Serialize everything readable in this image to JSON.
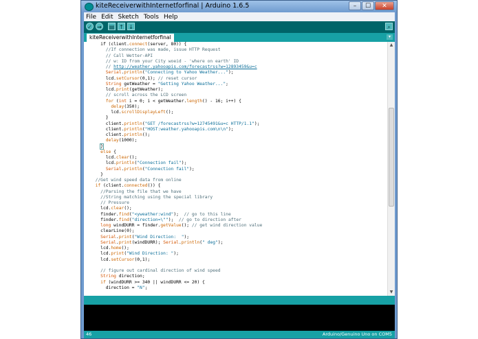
{
  "window": {
    "title": "kiteReceiverwithInternetforfinal | Arduino 1.6.5",
    "minimize": "–",
    "maximize": "☐",
    "close": "✕"
  },
  "menu": [
    "File",
    "Edit",
    "Sketch",
    "Tools",
    "Help"
  ],
  "toolbar": {
    "verify": "✓",
    "upload": "→",
    "new": "▤",
    "open": "↑",
    "save": "↓",
    "serial_monitor": "⌕"
  },
  "tabs": {
    "active": "kiteReceiverwithInternetforfinal",
    "menu_glyph": "▾"
  },
  "code": [
    [
      [
        "    ",
        ""
      ],
      [
        "if (client.",
        ""
      ],
      [
        "connect",
        "k"
      ],
      [
        "(server, 80)) {",
        ""
      ]
    ],
    [
      [
        "      //If connection was made, issue HTTP Request",
        "c"
      ]
    ],
    [
      [
        "      // Call Wetter-API",
        "c"
      ]
    ],
    [
      [
        "      // w: ID from your City woeid - 'where on earth' ID",
        "c"
      ]
    ],
    [
      [
        "      // ",
        "c"
      ],
      [
        "http://weather.yahooapis.com/forecastrss?w=12893459&u=c",
        "u"
      ]
    ],
    [
      [
        "      ",
        ""
      ],
      [
        "Serial",
        "t"
      ],
      [
        ".",
        ""
      ],
      [
        "println",
        "k"
      ],
      [
        "(",
        ""
      ],
      [
        "\"Connecting to Yahoo Weather...\"",
        "s"
      ],
      [
        ");",
        ""
      ]
    ],
    [
      [
        "      lcd.",
        ""
      ],
      [
        "setCursor",
        "k"
      ],
      [
        "(0,1); ",
        ""
      ],
      [
        "// reset cursor",
        "c"
      ]
    ],
    [
      [
        "      ",
        ""
      ],
      [
        "String",
        "t"
      ],
      [
        " getWeather = ",
        ""
      ],
      [
        "\"Getting Yahoo Weather...\"",
        "s"
      ],
      [
        ";",
        ""
      ]
    ],
    [
      [
        "      lcd.",
        ""
      ],
      [
        "print",
        "k"
      ],
      [
        "(getWeather);",
        ""
      ]
    ],
    [
      [
        "      // scroll across the LCD screen",
        "c"
      ]
    ],
    [
      [
        "      ",
        ""
      ],
      [
        "for",
        "k"
      ],
      [
        " (",
        ""
      ],
      [
        "int",
        "t"
      ],
      [
        " i = 0; i < getWeather.",
        ""
      ],
      [
        "length",
        "k"
      ],
      [
        "() - 16; i++) {",
        ""
      ]
    ],
    [
      [
        "        ",
        ""
      ],
      [
        "delay",
        "k"
      ],
      [
        "(350);",
        ""
      ]
    ],
    [
      [
        "        lcd.",
        ""
      ],
      [
        "scrollDisplayLeft",
        "k"
      ],
      [
        "();",
        ""
      ]
    ],
    [
      [
        "      }",
        ""
      ]
    ],
    [
      [
        "      client.",
        ""
      ],
      [
        "println",
        "k"
      ],
      [
        "(",
        ""
      ],
      [
        "\"GET /forecastrss?w=12745491&u=c HTTP/1.1\"",
        "s"
      ],
      [
        ");",
        ""
      ]
    ],
    [
      [
        "      client.",
        ""
      ],
      [
        "println",
        "k"
      ],
      [
        "(",
        ""
      ],
      [
        "\"HOST:weather.yahooapis.com\\n\\n\"",
        "s"
      ],
      [
        ");",
        ""
      ]
    ],
    [
      [
        "      client.",
        ""
      ],
      [
        "println",
        "k"
      ],
      [
        "();",
        ""
      ]
    ],
    [
      [
        "      ",
        ""
      ],
      [
        "delay",
        "k"
      ],
      [
        "(1000);",
        ""
      ]
    ],
    [
      [
        "    ",
        ""
      ],
      [
        "}",
        "x"
      ]
    ],
    [
      [
        "    ",
        ""
      ],
      [
        "else",
        "k"
      ],
      [
        " {",
        ""
      ]
    ],
    [
      [
        "      lcd.",
        ""
      ],
      [
        "clear",
        "k"
      ],
      [
        "();",
        ""
      ]
    ],
    [
      [
        "      lcd.",
        ""
      ],
      [
        "println",
        "k"
      ],
      [
        "(",
        ""
      ],
      [
        "\"Connection fail\"",
        "s"
      ],
      [
        ");",
        ""
      ]
    ],
    [
      [
        "      ",
        ""
      ],
      [
        "Serial",
        "t"
      ],
      [
        ".",
        ""
      ],
      [
        "println",
        "k"
      ],
      [
        "(",
        ""
      ],
      [
        "\"Connection fail\"",
        "s"
      ],
      [
        ");",
        ""
      ]
    ],
    [
      [
        "    }",
        ""
      ]
    ],
    [
      [
        "  ",
        ""
      ],
      [
        "//Get wind speed data from online",
        "c"
      ]
    ],
    [
      [
        "  ",
        ""
      ],
      [
        "if",
        "k"
      ],
      [
        " (client.",
        ""
      ],
      [
        "connected",
        "k"
      ],
      [
        "()) {",
        ""
      ]
    ],
    [
      [
        "    //Parsing the file that we have",
        "c"
      ]
    ],
    [
      [
        "    //String matching using the special library",
        "c"
      ]
    ],
    [
      [
        "    // Pressure",
        "c"
      ]
    ],
    [
      [
        "    lcd.",
        ""
      ],
      [
        "clear",
        "k"
      ],
      [
        "();",
        ""
      ]
    ],
    [
      [
        "    finder.",
        ""
      ],
      [
        "find",
        "k"
      ],
      [
        "(",
        ""
      ],
      [
        "\"<yweather:wind\"",
        "s"
      ],
      [
        ");  ",
        ""
      ],
      [
        "// go to this line",
        "c"
      ]
    ],
    [
      [
        "    finder.",
        ""
      ],
      [
        "find",
        "k"
      ],
      [
        "(",
        ""
      ],
      [
        "\"direction=\\\"\"",
        "s"
      ],
      [
        ");  ",
        ""
      ],
      [
        "// go to direction after",
        "c"
      ]
    ],
    [
      [
        "    ",
        ""
      ],
      [
        "long",
        "t"
      ],
      [
        " windDURR = finder.",
        ""
      ],
      [
        "getValue",
        "k"
      ],
      [
        "(); ",
        ""
      ],
      [
        "// get wind direction value",
        "c"
      ]
    ],
    [
      [
        "    clearLine(0);",
        ""
      ]
    ],
    [
      [
        "    ",
        ""
      ],
      [
        "Serial",
        "t"
      ],
      [
        ".",
        ""
      ],
      [
        "print",
        "k"
      ],
      [
        "(",
        ""
      ],
      [
        "\"Wind Direction:  \"",
        "s"
      ],
      [
        ");",
        ""
      ]
    ],
    [
      [
        "    ",
        ""
      ],
      [
        "Serial",
        "t"
      ],
      [
        ".",
        ""
      ],
      [
        "print",
        "k"
      ],
      [
        "(windDURR); ",
        ""
      ],
      [
        "Serial",
        "t"
      ],
      [
        ".",
        ""
      ],
      [
        "println",
        "k"
      ],
      [
        "(",
        ""
      ],
      [
        "\" deg\"",
        "s"
      ],
      [
        ");",
        ""
      ]
    ],
    [
      [
        "    lcd.",
        ""
      ],
      [
        "home",
        "k"
      ],
      [
        "();",
        ""
      ]
    ],
    [
      [
        "    lcd.",
        ""
      ],
      [
        "print",
        "k"
      ],
      [
        "(",
        ""
      ],
      [
        "\"Wind Direction: \"",
        "s"
      ],
      [
        ");",
        ""
      ]
    ],
    [
      [
        "    lcd.",
        ""
      ],
      [
        "setCursor",
        "k"
      ],
      [
        "(0,1);",
        ""
      ]
    ],
    [
      [
        "",
        ""
      ]
    ],
    [
      [
        "    // figure out cardinal direction of wind speed",
        "c"
      ]
    ],
    [
      [
        "    ",
        ""
      ],
      [
        "String",
        "t"
      ],
      [
        " direction;",
        ""
      ]
    ],
    [
      [
        "    ",
        ""
      ],
      [
        "if",
        "k"
      ],
      [
        " (windDURR >= 340 || windDURR <= 20) {",
        ""
      ]
    ],
    [
      [
        "      direction = ",
        ""
      ],
      [
        "\"N\"",
        "s"
      ],
      [
        ";",
        ""
      ]
    ]
  ],
  "scrollbar": {
    "up": "▲",
    "down": "▼"
  },
  "status": {
    "line_number": "46",
    "board": "Arduino/Genuino Uno on COM5"
  }
}
